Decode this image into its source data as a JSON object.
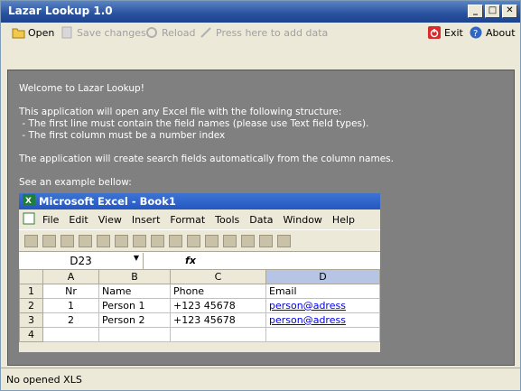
{
  "window": {
    "title": "Lazar Lookup 1.0"
  },
  "toolbar": {
    "open": "Open",
    "save": "Save changes",
    "reload": "Reload",
    "add": "Press here to add data",
    "exit": "Exit",
    "about": "About"
  },
  "content": {
    "welcome": "Welcome to Lazar Lookup!",
    "info1": "This application will open any Excel file with the following structure:",
    "info2": " - The first line must contain the field names (please use Text field types).",
    "info3": " - The first column must be a number index",
    "info4": "The application will create search fields automatically from the column names.",
    "info5": "See an example bellow:"
  },
  "excel": {
    "title": "Microsoft Excel - Book1",
    "menu": [
      "File",
      "Edit",
      "View",
      "Insert",
      "Format",
      "Tools",
      "Data",
      "Window",
      "Help"
    ],
    "namebox": "D23",
    "fx": "fx",
    "col_headers": [
      "A",
      "B",
      "C",
      "D"
    ],
    "rows": [
      {
        "n": "1",
        "a": "Nr",
        "b": "Name",
        "c": "Phone",
        "d": "Email"
      },
      {
        "n": "2",
        "a": "1",
        "b": "Person 1",
        "c": "+123 45678",
        "d": "person@adress"
      },
      {
        "n": "3",
        "a": "2",
        "b": "Person 2",
        "c": "+123 45678",
        "d": "person@adress"
      },
      {
        "n": "4",
        "a": "",
        "b": "",
        "c": "",
        "d": ""
      }
    ]
  },
  "status": "No opened XLS"
}
